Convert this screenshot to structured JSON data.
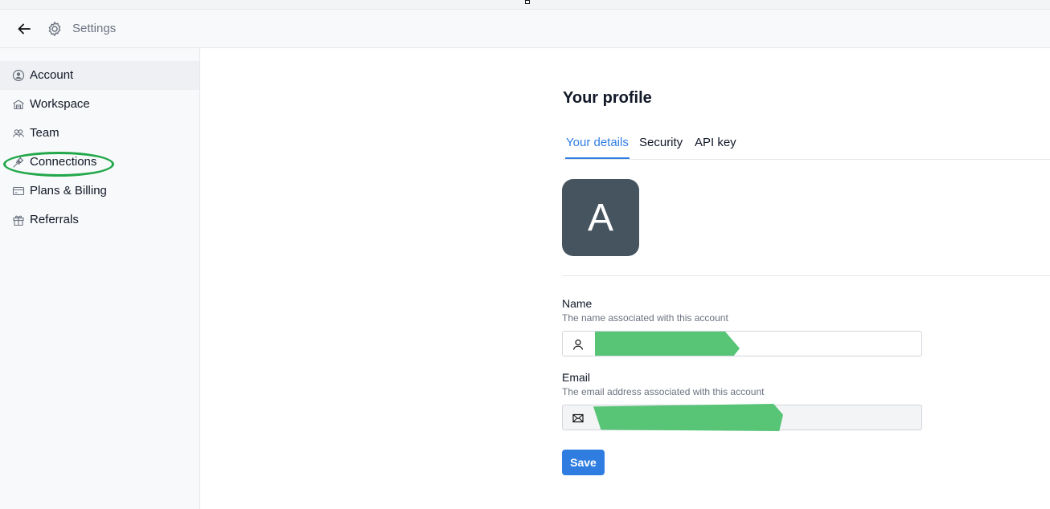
{
  "header": {
    "title": "Settings"
  },
  "sidebar": {
    "items": [
      {
        "label": "Account",
        "icon": "user-circle-icon"
      },
      {
        "label": "Workspace",
        "icon": "building-icon"
      },
      {
        "label": "Team",
        "icon": "users-icon"
      },
      {
        "label": "Connections",
        "icon": "plug-icon"
      },
      {
        "label": "Plans & Billing",
        "icon": "credit-card-icon"
      },
      {
        "label": "Referrals",
        "icon": "gift-icon"
      }
    ],
    "active": "Account"
  },
  "profile": {
    "title": "Your profile",
    "tabs": [
      {
        "label": "Your details"
      },
      {
        "label": "Security"
      },
      {
        "label": "API key"
      }
    ],
    "avatar_initial": "A",
    "name": {
      "label": "Name",
      "help": "The name associated with this account",
      "value": ""
    },
    "email": {
      "label": "Email",
      "help": "The email address associated with this account",
      "value": ""
    },
    "save_label": "Save"
  },
  "colors": {
    "accent": "#2f7de1",
    "avatar_bg": "#46545f",
    "highlight": "#22a84a",
    "redaction": "#57c476"
  }
}
